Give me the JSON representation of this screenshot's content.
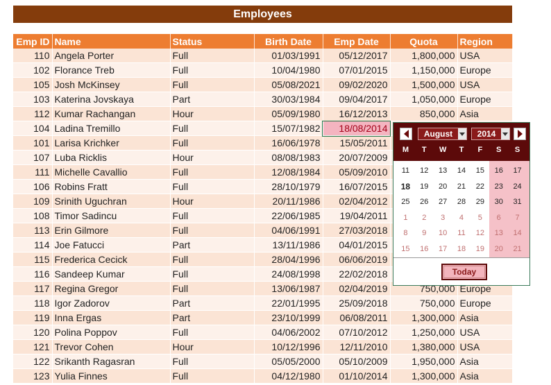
{
  "title": "Employees",
  "columns": [
    "Emp ID",
    "Name",
    "Status",
    "Birth Date",
    "Emp Date",
    "Quota",
    "Region"
  ],
  "rows": [
    [
      "110",
      "Angela Porter",
      "Full",
      "01/03/1991",
      "05/12/2017",
      "1,800,000",
      "USA"
    ],
    [
      "102",
      "Florance Treb",
      "Full",
      "10/04/1980",
      "07/01/2015",
      "1,150,000",
      "Europe"
    ],
    [
      "105",
      "Josh McKinsey",
      "Full",
      "05/08/2021",
      "09/02/2020",
      "1,500,000",
      "USA"
    ],
    [
      "103",
      "Katerina Jovskaya",
      "Part",
      "30/03/1984",
      "09/04/2017",
      "1,050,000",
      "Europe"
    ],
    [
      "112",
      "Kumar Rachangan",
      "Hour",
      "05/09/1980",
      "16/12/2013",
      "850,000",
      "Asia"
    ],
    [
      "104",
      "Ladina Tremillo",
      "Full",
      "15/07/1982",
      "18/08/2014",
      "",
      ""
    ],
    [
      "101",
      "Larisa Krichker",
      "Full",
      "16/06/1978",
      "15/05/2011",
      "",
      ""
    ],
    [
      "107",
      "Luba Ricklis",
      "Hour",
      "08/08/1983",
      "20/07/2009",
      "",
      ""
    ],
    [
      "111",
      "Michelle Cavallio",
      "Full",
      "12/08/1984",
      "05/09/2010",
      "",
      ""
    ],
    [
      "106",
      "Robins Fratt",
      "Full",
      "28/10/1979",
      "16/07/2015",
      "",
      ""
    ],
    [
      "109",
      "Srinith Uguchran",
      "Hour",
      "20/11/1986",
      "02/04/2012",
      "",
      ""
    ],
    [
      "108",
      "Timor Sadincu",
      "Full",
      "22/06/1985",
      "19/04/2011",
      "",
      ""
    ],
    [
      "113",
      "Erin Gilmore",
      "Full",
      "04/06/1991",
      "27/03/2018",
      "",
      ""
    ],
    [
      "114",
      "Joe Fatucci",
      "Part",
      "13/11/1986",
      "04/01/2015",
      "",
      ""
    ],
    [
      "115",
      "Frederica Cecick",
      "Full",
      "28/04/1996",
      "06/06/2019",
      "",
      ""
    ],
    [
      "116",
      "Sandeep Kumar",
      "Full",
      "24/08/1998",
      "22/02/2018",
      "",
      ""
    ],
    [
      "117",
      "Regina Gregor",
      "Full",
      "13/06/1987",
      "02/04/2019",
      "750,000",
      "Europe"
    ],
    [
      "118",
      "Igor Zadorov",
      "Part",
      "22/01/1995",
      "25/09/2018",
      "750,000",
      "Europe"
    ],
    [
      "119",
      "Inna Ergas",
      "Part",
      "23/10/1999",
      "06/08/2011",
      "1,300,000",
      "Asia"
    ],
    [
      "120",
      "Polina Poppov",
      "Full",
      "04/06/2002",
      "07/10/2012",
      "1,250,000",
      "USA"
    ],
    [
      "121",
      "Trevor Cohen",
      "Hour",
      "10/12/1996",
      "12/11/2010",
      "1,380,000",
      "USA"
    ],
    [
      "122",
      "Srikanth Ragasran",
      "Full",
      "05/05/2000",
      "05/10/2009",
      "1,950,000",
      "Asia"
    ],
    [
      "123",
      "Yulia Finnes",
      "Full",
      "04/12/1980",
      "01/10/2014",
      "1,300,000",
      "Asia"
    ]
  ],
  "selected_row": 5,
  "selected_col": 4,
  "picker": {
    "month": "August",
    "year": "2014",
    "weekdays": [
      "M",
      "T",
      "W",
      "T",
      "F",
      "S",
      "S"
    ],
    "days": [
      [
        "11",
        "12",
        "13",
        "14",
        "15",
        "16",
        "17"
      ],
      [
        "18",
        "19",
        "20",
        "21",
        "22",
        "23",
        "24"
      ],
      [
        "25",
        "26",
        "27",
        "28",
        "29",
        "30",
        "31"
      ],
      [
        "1",
        "2",
        "3",
        "4",
        "5",
        "6",
        "7"
      ],
      [
        "8",
        "9",
        "10",
        "11",
        "12",
        "13",
        "14"
      ],
      [
        "15",
        "16",
        "17",
        "18",
        "19",
        "20",
        "21"
      ]
    ],
    "muted_from_row": 3,
    "today_cell": [
      1,
      0
    ],
    "today_label": "Today"
  },
  "colors": {
    "title_bg": "#843c0c",
    "header_bg": "#ed7d31",
    "row_odd": "#fbe4d5",
    "row_even": "#fdf1ea",
    "picker_head": "#5c0a0a",
    "weekend": "#f5c1c8"
  },
  "icons": {
    "prev": "triangle-left-icon",
    "next": "triangle-right-icon",
    "dropdown": "triangle-down-icon"
  }
}
